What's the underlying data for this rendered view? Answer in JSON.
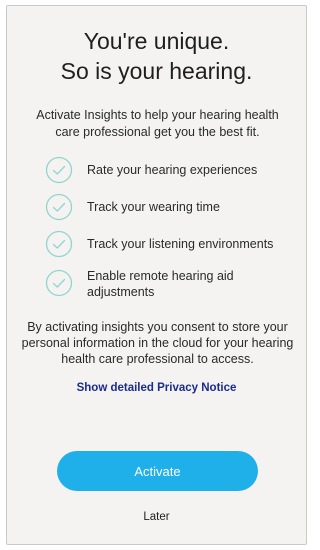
{
  "headline": {
    "line1": "You're unique.",
    "line2": "So is your hearing."
  },
  "intro": "Activate Insights to help your hearing health care professional get you the best fit.",
  "features": [
    {
      "icon": "check-circle-icon",
      "label": "Rate your hearing experiences"
    },
    {
      "icon": "check-circle-icon",
      "label": "Track your wearing time"
    },
    {
      "icon": "check-circle-icon",
      "label": "Track your listening environments"
    },
    {
      "icon": "check-circle-icon",
      "label": "Enable remote hearing aid adjustments"
    }
  ],
  "consent": "By activating insights you consent to store your personal information in the cloud for your hearing health care professional to access.",
  "privacy_link": "Show detailed Privacy Notice",
  "activate_button": "Activate",
  "later_link": "Later",
  "colors": {
    "background": "#f4f3f1",
    "accent": "#1fb0ea",
    "check_stroke": "#8fd6cf",
    "link": "#1a2c8c",
    "text": "#2a2a2a"
  }
}
